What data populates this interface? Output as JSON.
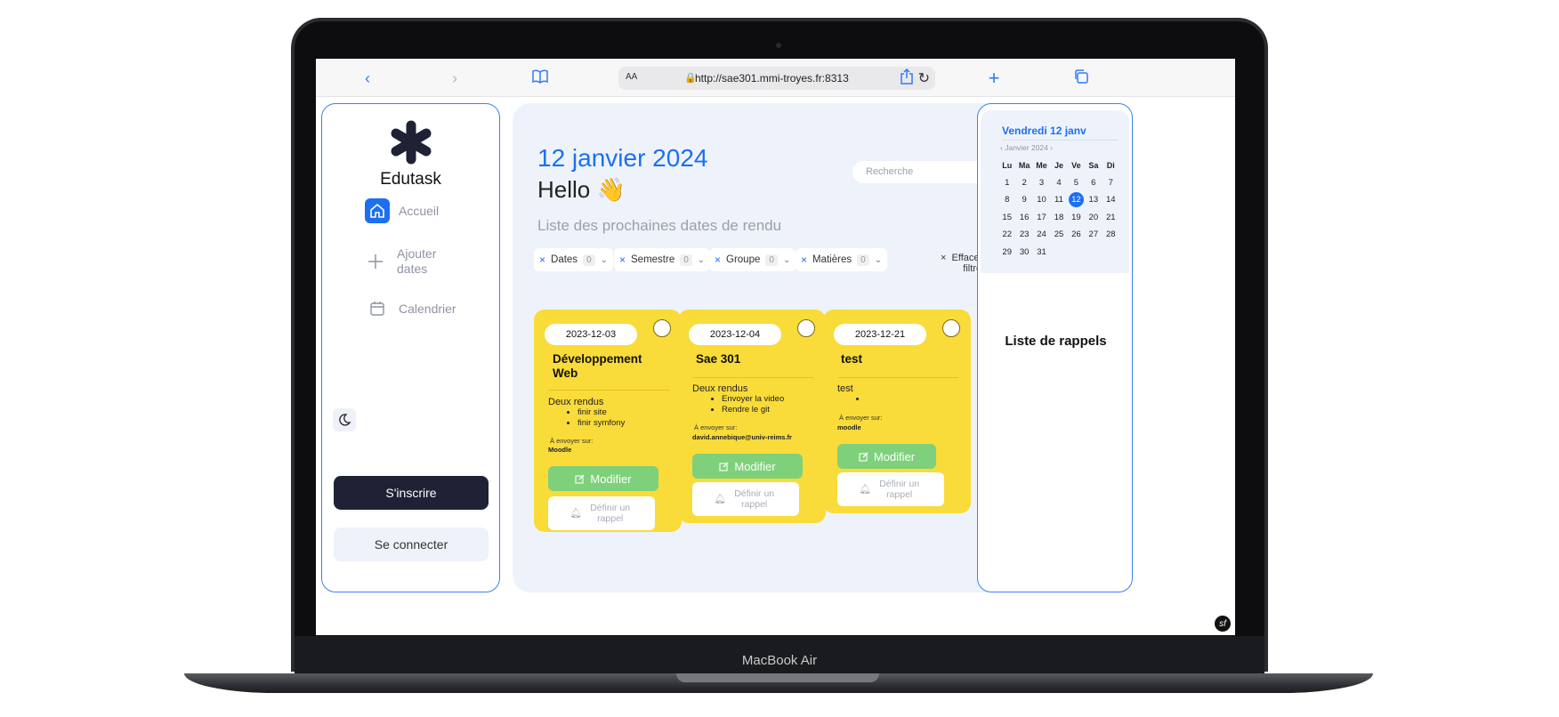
{
  "device": {
    "label": "MacBook Air"
  },
  "browser": {
    "aa_label": "AA",
    "url": "http://sae301.mmi-troyes.fr:8313"
  },
  "sidebar": {
    "brand": "Edutask",
    "nav": [
      {
        "label": "Accueil",
        "icon": "home-icon",
        "active": true
      },
      {
        "label": "Ajouter dates",
        "icon": "plus-icon",
        "active": false
      },
      {
        "label": "Calendrier",
        "icon": "calendar-icon",
        "active": false
      }
    ],
    "signup_label": "S'inscrire",
    "login_label": "Se connecter"
  },
  "main": {
    "date_title": "12 janvier 2024",
    "hello": "Hello",
    "hello_emoji": "👋",
    "subtitle": "Liste des prochaines dates de rendu",
    "search_placeholder": "Recherche",
    "filters": [
      {
        "label": "Dates",
        "count": "0"
      },
      {
        "label": "Semestre",
        "count": "0"
      },
      {
        "label": "Groupe",
        "count": "0"
      },
      {
        "label": "Matières",
        "count": "0"
      }
    ],
    "clear_filters": "Effacer les filtres",
    "cards": [
      {
        "date": "2023-12-03",
        "title": "Développement Web",
        "description": "Deux rendus",
        "items": [
          "finir site",
          "finir symfony"
        ],
        "send_label": "À envoyer sur:",
        "destination": "Moodle",
        "modify_label": "Modifier",
        "reminder_label": "Définir un rappel"
      },
      {
        "date": "2023-12-04",
        "title": "Sae 301",
        "description": "Deux rendus",
        "items": [
          "Envoyer la video",
          "Rendre le git"
        ],
        "send_label": "À envoyer sur:",
        "destination": "david.annebique@univ-reims.fr",
        "modify_label": "Modifier",
        "reminder_label": "Définir un rappel"
      },
      {
        "date": "2023-12-21",
        "title": "test",
        "description": "test",
        "items": [
          ""
        ],
        "send_label": "À envoyer sur:",
        "destination": "moodle",
        "modify_label": "Modifier",
        "reminder_label": "Définir un rappel"
      }
    ]
  },
  "calendar": {
    "header": "Vendredi 12 janv",
    "month": "Janvier 2024",
    "weekdays": [
      "Lu",
      "Ma",
      "Me",
      "Je",
      "Ve",
      "Sa",
      "Di"
    ],
    "weeks": [
      [
        "1",
        "2",
        "3",
        "4",
        "5",
        "6",
        "7"
      ],
      [
        "8",
        "9",
        "10",
        "11",
        "12",
        "13",
        "14"
      ],
      [
        "15",
        "16",
        "17",
        "18",
        "19",
        "20",
        "21"
      ],
      [
        "22",
        "23",
        "24",
        "25",
        "26",
        "27",
        "28"
      ],
      [
        "29",
        "30",
        "31",
        "",
        "",
        "",
        ""
      ]
    ],
    "today": "12",
    "reminders_title": "Liste de rappels"
  },
  "colors": {
    "accent": "#1d6ff2",
    "card": "#f9db3a",
    "modify": "#7ed17a",
    "dark": "#1f2235"
  }
}
